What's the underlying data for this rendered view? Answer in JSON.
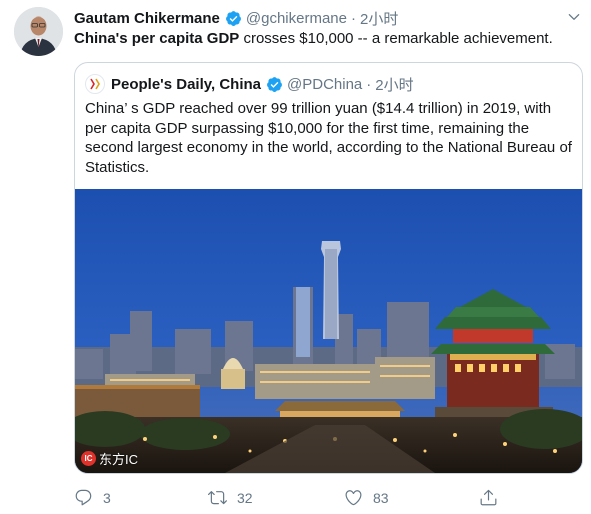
{
  "tweet": {
    "author_name": "Gautam Chikermane",
    "handle": "@gchikermane",
    "separator": "·",
    "time": "2小时",
    "text_bold": "China's per capita GDP",
    "text_rest": " crosses $10,000 -- a remarkable achievement.",
    "avatar_icon": "user-avatar",
    "verified_icon": "verified-badge-icon",
    "menu_icon": "chevron-down-icon"
  },
  "quoted": {
    "author_name": "People's Daily, China",
    "handle": "@PDChina",
    "separator": "·",
    "time": "2小时",
    "text": "China’ s GDP reached over 99 trillion yuan ($14.4 trillion) in 2019, with per capita GDP surpassing $10,000 for the first time, remaining the second largest economy in the world, according to the National Bureau of Statistics.",
    "media_credit": "东方IC",
    "media_credit_mark": "IC"
  },
  "actions": {
    "reply_count": "3",
    "retweet_count": "32",
    "like_count": "83"
  },
  "colors": {
    "accent": "#1da1f2",
    "muted": "#657786",
    "border": "#ccd6dd"
  }
}
